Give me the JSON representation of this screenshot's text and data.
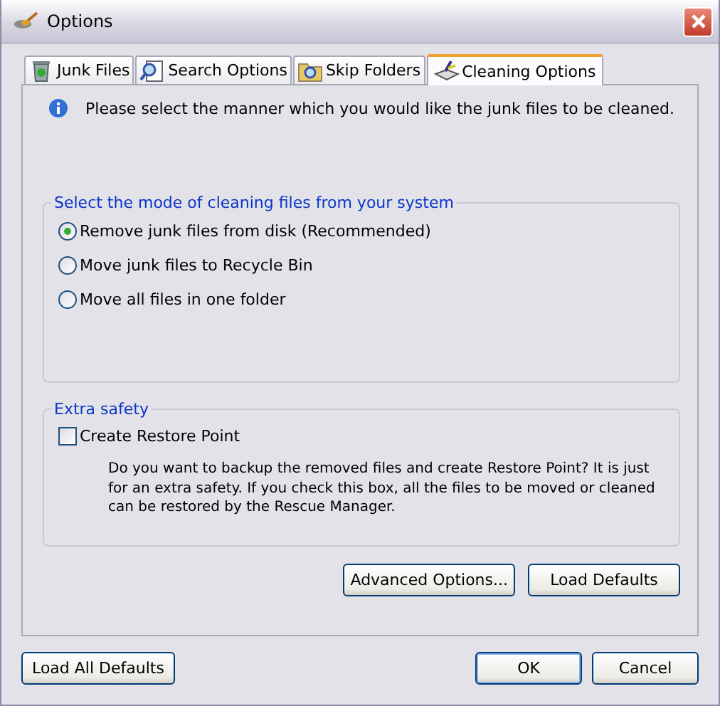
{
  "window": {
    "title": "Options"
  },
  "tabs": [
    {
      "label": "Junk Files",
      "selected": false,
      "kind": "bin"
    },
    {
      "label": "Search Options",
      "selected": false,
      "kind": "search"
    },
    {
      "label": "Skip Folders",
      "selected": false,
      "kind": "folder"
    },
    {
      "label": "Cleaning Options",
      "selected": true,
      "kind": "broom"
    }
  ],
  "info": "Please select the manner which you would like the junk files to be cleaned.",
  "mode_group": {
    "title": "Select the mode of cleaning files from your system",
    "options": [
      {
        "label": "Remove junk files from disk (Recommended)",
        "selected": true
      },
      {
        "label": "Move junk files to Recycle Bin",
        "selected": false
      },
      {
        "label": "Move all files in one folder",
        "selected": false
      }
    ]
  },
  "safety_group": {
    "title": "Extra safety",
    "checkbox": {
      "label": "Create Restore Point",
      "checked": false
    },
    "description": "Do you want to backup the removed files and create Restore Point? It is just for an extra safety. If you check this box, all the files to be moved or cleaned can be restored by the Rescue Manager."
  },
  "panel_buttons": [
    "Advanced Options...",
    "Load Defaults"
  ],
  "footer": {
    "left_button": "Load All Defaults",
    "buttons": [
      "OK",
      "Cancel"
    ]
  }
}
